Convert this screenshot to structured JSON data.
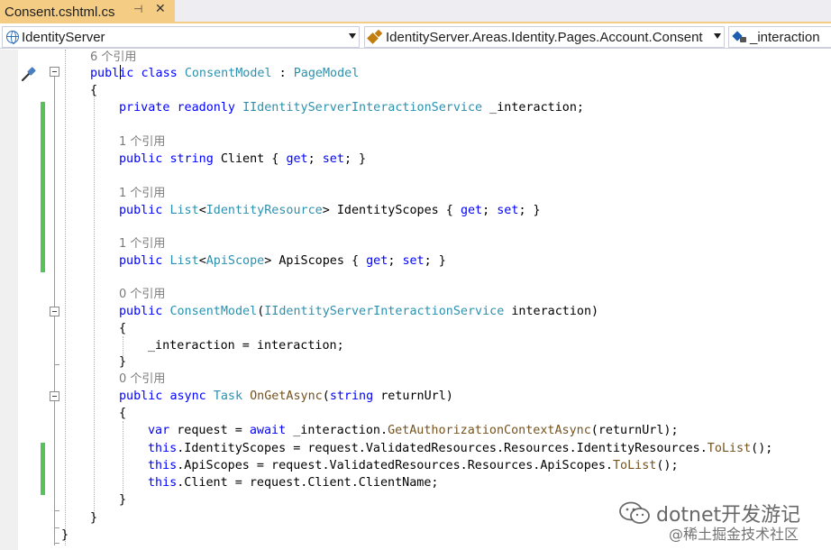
{
  "tab": {
    "title": "Consent.cshtml.cs",
    "pin_icon": "pin-icon",
    "close_icon": "close-icon"
  },
  "navbar": {
    "project": "IdentityServer",
    "type": "IdentityServer.Areas.Identity.Pages.Account.Consent",
    "member": "_interaction"
  },
  "colors": {
    "keyword": "#0000ff",
    "type": "#2b91af",
    "method": "#74531f",
    "codelens": "#7a7a7a",
    "change_bar": "#57c25a",
    "active_tab": "#f5cc84"
  },
  "code": [
    {
      "kind": "lens",
      "text": "6 个引用"
    },
    {
      "kind": "code",
      "tokens": [
        [
          "public",
          "kw"
        ],
        [
          " ",
          "pl"
        ],
        [
          "class",
          "kw"
        ],
        [
          " ",
          "pl"
        ],
        [
          "ConsentModel",
          "ty"
        ],
        [
          " : ",
          "pl"
        ],
        [
          "PageModel",
          "ty"
        ]
      ]
    },
    {
      "kind": "code",
      "tokens": [
        [
          "{",
          "pl"
        ]
      ]
    },
    {
      "kind": "code",
      "tokens": [
        [
          "private",
          "kw"
        ],
        [
          " ",
          "pl"
        ],
        [
          "readonly",
          "kw"
        ],
        [
          " ",
          "pl"
        ],
        [
          "IIdentityServerInteractionService",
          "ty"
        ],
        [
          " _interaction;",
          "pl"
        ]
      ]
    },
    {
      "kind": "blank"
    },
    {
      "kind": "lens",
      "text": "1 个引用"
    },
    {
      "kind": "code",
      "tokens": [
        [
          "public",
          "kw"
        ],
        [
          " ",
          "pl"
        ],
        [
          "string",
          "kw"
        ],
        [
          " Client { ",
          "pl"
        ],
        [
          "get",
          "kw"
        ],
        [
          "; ",
          "pl"
        ],
        [
          "set",
          "kw"
        ],
        [
          "; }",
          "pl"
        ]
      ]
    },
    {
      "kind": "blank"
    },
    {
      "kind": "lens",
      "text": "1 个引用"
    },
    {
      "kind": "code",
      "tokens": [
        [
          "public",
          "kw"
        ],
        [
          " ",
          "pl"
        ],
        [
          "List",
          "ty"
        ],
        [
          "<",
          "pl"
        ],
        [
          "IdentityResource",
          "ty"
        ],
        [
          "> IdentityScopes { ",
          "pl"
        ],
        [
          "get",
          "kw"
        ],
        [
          "; ",
          "pl"
        ],
        [
          "set",
          "kw"
        ],
        [
          "; }",
          "pl"
        ]
      ]
    },
    {
      "kind": "blank"
    },
    {
      "kind": "lens",
      "text": "1 个引用"
    },
    {
      "kind": "code",
      "tokens": [
        [
          "public",
          "kw"
        ],
        [
          " ",
          "pl"
        ],
        [
          "List",
          "ty"
        ],
        [
          "<",
          "pl"
        ],
        [
          "ApiScope",
          "ty"
        ],
        [
          "> ApiScopes { ",
          "pl"
        ],
        [
          "get",
          "kw"
        ],
        [
          "; ",
          "pl"
        ],
        [
          "set",
          "kw"
        ],
        [
          "; }",
          "pl"
        ]
      ]
    },
    {
      "kind": "blank"
    },
    {
      "kind": "lens",
      "text": "0 个引用"
    },
    {
      "kind": "code",
      "tokens": [
        [
          "public",
          "kw"
        ],
        [
          " ",
          "pl"
        ],
        [
          "ConsentModel",
          "ty"
        ],
        [
          "(",
          "pl"
        ],
        [
          "IIdentityServerInteractionService",
          "ty"
        ],
        [
          " interaction)",
          "pl"
        ]
      ]
    },
    {
      "kind": "code",
      "tokens": [
        [
          "{",
          "pl"
        ]
      ]
    },
    {
      "kind": "code",
      "tokens": [
        [
          "_interaction = ",
          "pl"
        ],
        [
          "interaction",
          "pl"
        ],
        [
          ";",
          "pl"
        ]
      ]
    },
    {
      "kind": "code",
      "tokens": [
        [
          "}",
          "pl"
        ]
      ]
    },
    {
      "kind": "lens",
      "text": "0 个引用"
    },
    {
      "kind": "code",
      "tokens": [
        [
          "public",
          "kw"
        ],
        [
          " ",
          "pl"
        ],
        [
          "async",
          "kw"
        ],
        [
          " ",
          "pl"
        ],
        [
          "Task",
          "ty"
        ],
        [
          " ",
          "pl"
        ],
        [
          "OnGetAsync",
          "mt"
        ],
        [
          "(",
          "pl"
        ],
        [
          "string",
          "kw"
        ],
        [
          " returnUrl)",
          "pl"
        ]
      ]
    },
    {
      "kind": "code",
      "tokens": [
        [
          "{",
          "pl"
        ]
      ]
    },
    {
      "kind": "code",
      "tokens": [
        [
          "var",
          "kw"
        ],
        [
          " request = ",
          "pl"
        ],
        [
          "await",
          "kw"
        ],
        [
          " _interaction.",
          "pl"
        ],
        [
          "GetAuthorizationContextAsync",
          "mt"
        ],
        [
          "(returnUrl);",
          "pl"
        ]
      ]
    },
    {
      "kind": "code",
      "tokens": [
        [
          "this",
          "kw"
        ],
        [
          ".IdentityScopes = request.ValidatedResources.Resources.IdentityResources.",
          "pl"
        ],
        [
          "ToList",
          "mt"
        ],
        [
          "();",
          "pl"
        ]
      ]
    },
    {
      "kind": "code",
      "tokens": [
        [
          "this",
          "kw"
        ],
        [
          ".ApiScopes = request.ValidatedResources.Resources.ApiScopes.",
          "pl"
        ],
        [
          "ToList",
          "mt"
        ],
        [
          "();",
          "pl"
        ]
      ]
    },
    {
      "kind": "code",
      "tokens": [
        [
          "this",
          "kw"
        ],
        [
          ".Client = request.Client.ClientName;",
          "pl"
        ]
      ]
    },
    {
      "kind": "code",
      "tokens": [
        [
          "}",
          "pl"
        ]
      ]
    },
    {
      "kind": "code",
      "tokens": [
        [
          "}",
          "pl"
        ]
      ]
    },
    {
      "kind": "code",
      "tokens": [
        [
          "}",
          "pl"
        ]
      ]
    }
  ],
  "watermark": {
    "line1": "dotnet开发游记",
    "line2": "@稀土掘金技术社区"
  }
}
